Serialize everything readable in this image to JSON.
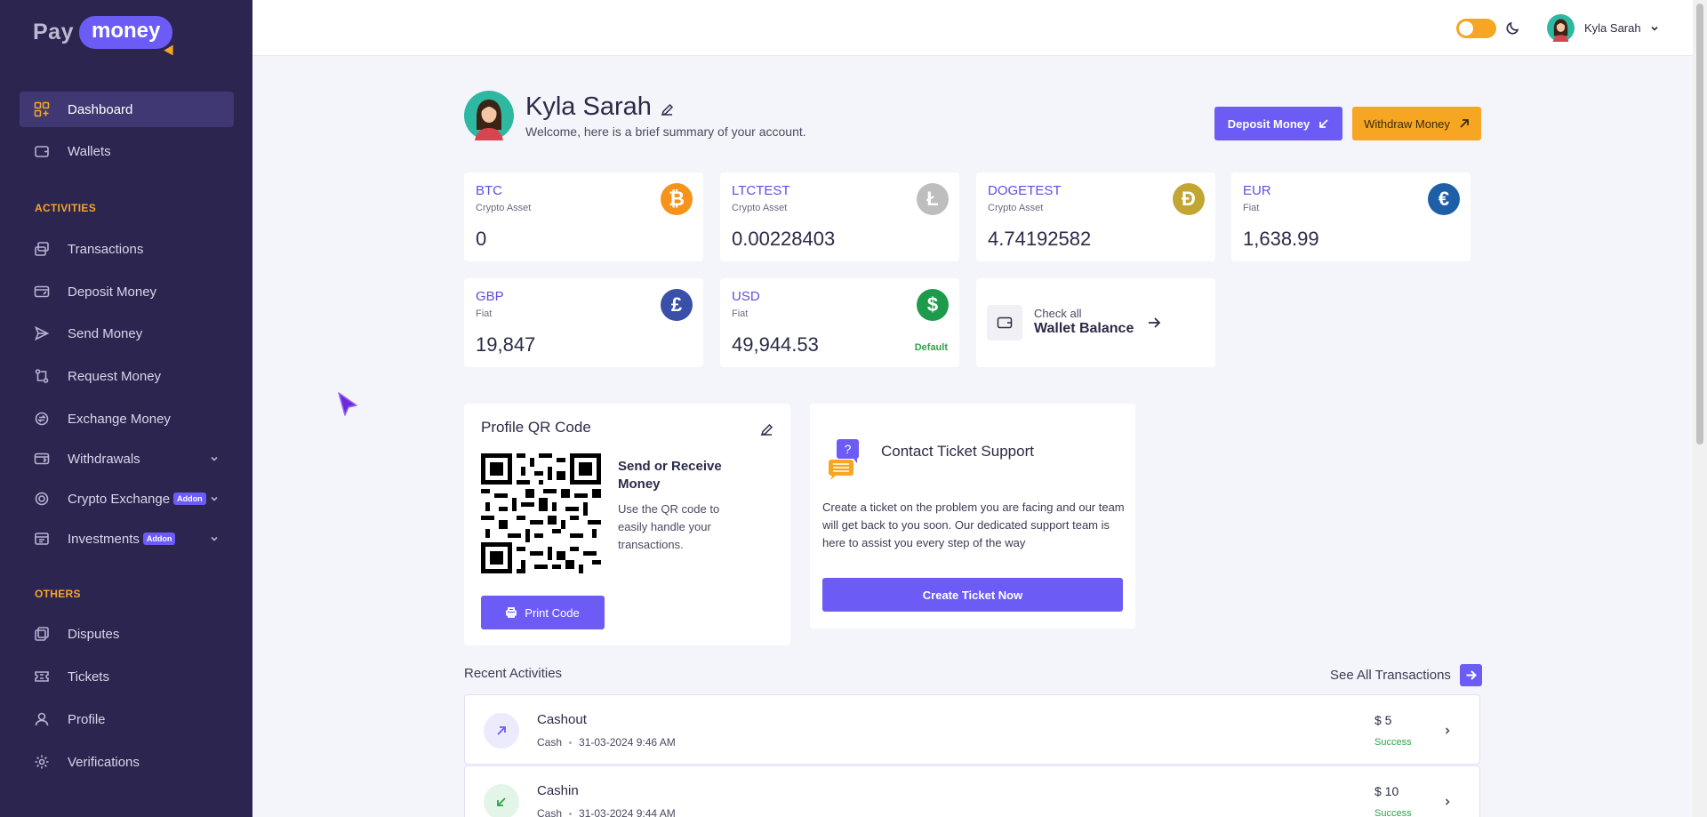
{
  "brand": {
    "pay": "Pay",
    "money": "money"
  },
  "sidebar": {
    "items_main": [
      {
        "label": "Dashboard",
        "icon": "dashboard-icon"
      },
      {
        "label": "Wallets",
        "icon": "wallet-icon"
      }
    ],
    "section_activities": "ACTIVITIES",
    "items_activities": [
      {
        "label": "Transactions",
        "icon": "transactions-icon"
      },
      {
        "label": "Deposit Money",
        "icon": "deposit-icon"
      },
      {
        "label": "Send Money",
        "icon": "send-icon"
      },
      {
        "label": "Request Money",
        "icon": "request-icon"
      },
      {
        "label": "Exchange Money",
        "icon": "exchange-icon"
      },
      {
        "label": "Withdrawals",
        "icon": "withdrawals-icon"
      },
      {
        "label": "Crypto Exchange",
        "icon": "crypto-exchange-icon",
        "badge": "Addon"
      },
      {
        "label": "Investments",
        "icon": "investments-icon",
        "badge": "Addon"
      }
    ],
    "section_others": "OTHERS",
    "items_others": [
      {
        "label": "Disputes",
        "icon": "disputes-icon"
      },
      {
        "label": "Tickets",
        "icon": "tickets-icon"
      },
      {
        "label": "Profile",
        "icon": "profile-icon"
      },
      {
        "label": "Verifications",
        "icon": "verifications-icon"
      }
    ]
  },
  "topbar": {
    "user_name": "Kyla Sarah"
  },
  "header": {
    "name": "Kyla Sarah",
    "welcome": "Welcome, here is a brief summary of your account.",
    "deposit_label": "Deposit Money",
    "withdraw_label": "Withdraw Money"
  },
  "wallets": [
    {
      "code": "BTC",
      "type": "Crypto Asset",
      "balance": "0",
      "symbol": "₿",
      "color": "#f7931a"
    },
    {
      "code": "LTCTEST",
      "type": "Crypto Asset",
      "balance": "0.00228403",
      "symbol": "Ł",
      "color": "#bebebe"
    },
    {
      "code": "DOGETEST",
      "type": "Crypto Asset",
      "balance": "4.74192582",
      "symbol": "Ð",
      "color": "#c2a633"
    },
    {
      "code": "EUR",
      "type": "Fiat",
      "balance": "1,638.99",
      "symbol": "€",
      "color": "#1f5fa8"
    },
    {
      "code": "GBP",
      "type": "Fiat",
      "balance": "19,847",
      "symbol": "£",
      "color": "#3a4fa8"
    },
    {
      "code": "USD",
      "type": "Fiat",
      "balance": "49,944.53",
      "symbol": "$",
      "color": "#1e9a4b",
      "default": "Default"
    }
  ],
  "check_all": {
    "small": "Check all",
    "big": "Wallet Balance"
  },
  "qr": {
    "title": "Profile QR Code",
    "send_receive": "Send or Receive Money",
    "description": "Use the QR code to easily handle your transactions.",
    "print_label": "Print Code"
  },
  "ticket": {
    "title": "Contact Ticket Support",
    "description": "Create a ticket on the problem you are facing and our team will get back to you soon. Our dedicated support team is here to assist you every step of the way",
    "button": "Create Ticket Now"
  },
  "recent": {
    "label": "Recent Activities",
    "see_all": "See All Transactions",
    "items": [
      {
        "title": "Cashout",
        "method": "Cash",
        "date": "31-03-2024 9:46 AM",
        "amount": "$ 5",
        "status": "Success",
        "direction": "out"
      },
      {
        "title": "Cashin",
        "method": "Cash",
        "date": "31-03-2024 9:44 AM",
        "amount": "$ 10",
        "status": "Success",
        "direction": "in"
      }
    ]
  }
}
